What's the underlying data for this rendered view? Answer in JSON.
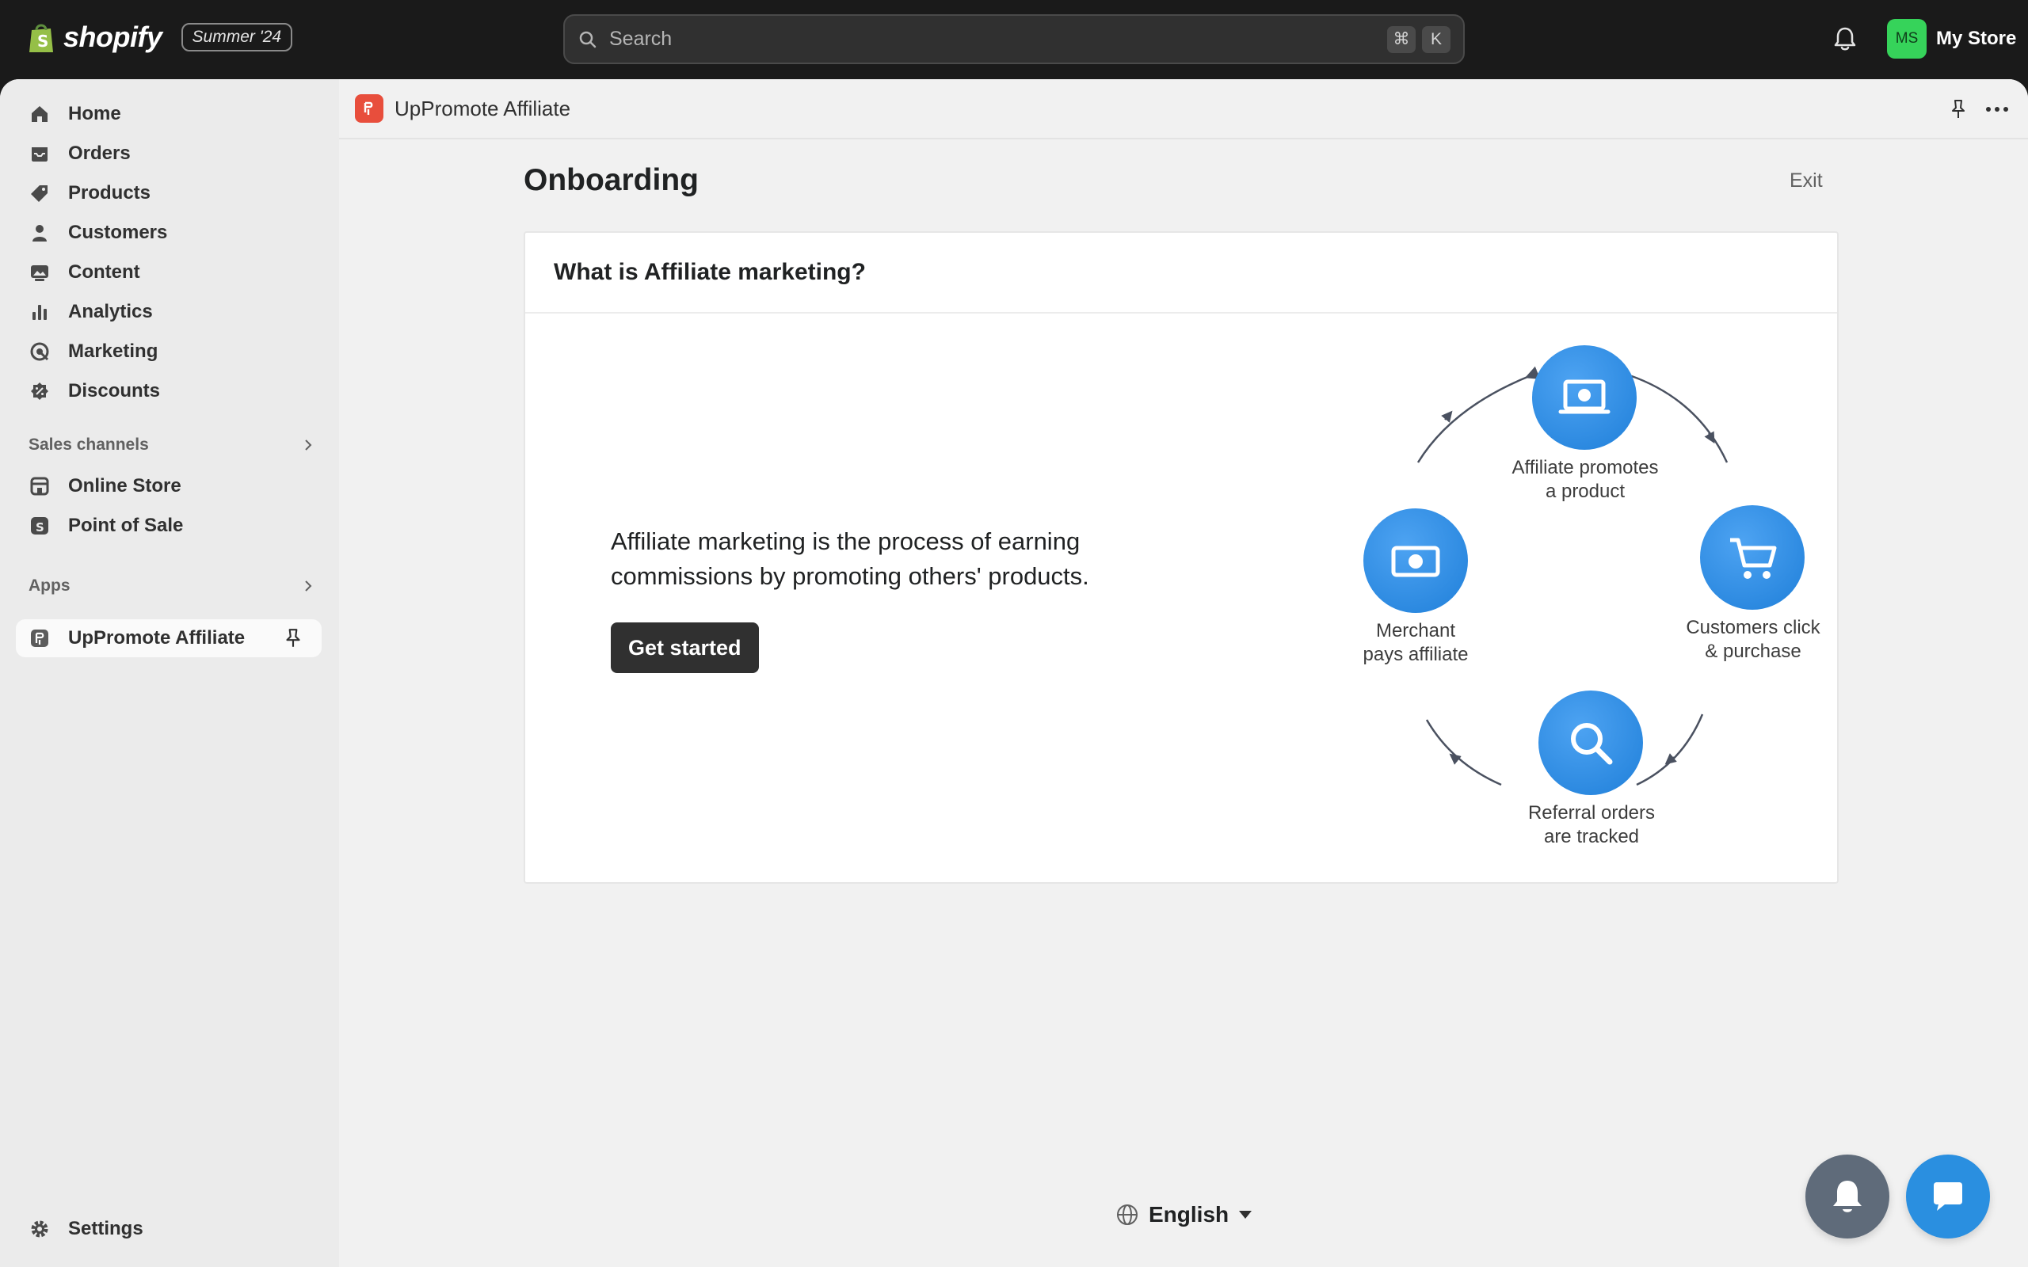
{
  "topbar": {
    "brand": "shopify",
    "edition": "Summer '24",
    "search_placeholder": "Search",
    "shortcut_keys": [
      "⌘",
      "K"
    ],
    "avatar_initials": "MS",
    "store_name": "My Store"
  },
  "sidebar": {
    "main_items": [
      {
        "label": "Home",
        "icon": "home-icon"
      },
      {
        "label": "Orders",
        "icon": "inbox-icon"
      },
      {
        "label": "Products",
        "icon": "tag-icon"
      },
      {
        "label": "Customers",
        "icon": "person-icon"
      },
      {
        "label": "Content",
        "icon": "image-icon"
      },
      {
        "label": "Analytics",
        "icon": "bar-chart-icon"
      },
      {
        "label": "Marketing",
        "icon": "target-icon"
      },
      {
        "label": "Discounts",
        "icon": "discount-icon"
      }
    ],
    "sales_channels_label": "Sales channels",
    "sales_channels": [
      {
        "label": "Online Store",
        "icon": "store-icon"
      },
      {
        "label": "Point of Sale",
        "icon": "pos-icon"
      }
    ],
    "apps_label": "Apps",
    "apps": [
      {
        "label": "UpPromote Affiliate",
        "icon": "uppromote-icon"
      }
    ],
    "settings_label": "Settings"
  },
  "app_header": {
    "title": "UpPromote Affiliate"
  },
  "page": {
    "title": "Onboarding",
    "exit_label": "Exit",
    "card_title": "What is Affiliate marketing?",
    "description": "Affiliate marketing is the process of earning commissions by promoting others' products.",
    "cta_label": "Get started",
    "cycle": {
      "top": [
        "Affiliate promotes",
        "a product"
      ],
      "right": [
        "Customers click",
        "& purchase"
      ],
      "bottom": [
        "Referral orders",
        "are tracked"
      ],
      "left": [
        "Merchant",
        "pays affiliate"
      ]
    },
    "language": "English"
  },
  "colors": {
    "topbar": "#1a1a1a",
    "accent_blue": "#2a8fe0",
    "app_logo": "#e84e3c",
    "avatar": "#36d35a"
  }
}
